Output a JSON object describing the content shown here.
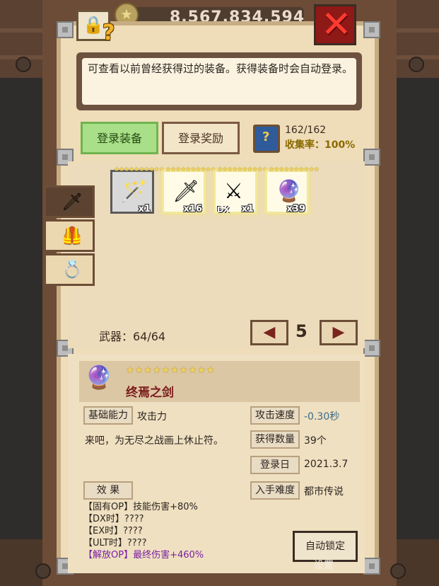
{
  "header": {
    "currency": "8,567,834,594"
  },
  "description": "可查看以前曾经获得过的装备。获得装备时会自动登录。",
  "tabs": [
    {
      "label": "登录装备",
      "active": true
    },
    {
      "label": "登录奖励",
      "active": false
    }
  ],
  "collection": {
    "count": "162/162",
    "rate": "收集率：100%"
  },
  "side_tabs": [
    {
      "icon": "sword-icon",
      "active": true
    },
    {
      "icon": "armor-icon",
      "active": false
    },
    {
      "icon": "ring-icon",
      "active": false
    }
  ],
  "items": [
    {
      "icon": "golden-staff-icon",
      "stars": "★★★★★★★★★★",
      "qty": "x1",
      "dx": "",
      "selected": true
    },
    {
      "icon": "crimson-sword-icon",
      "stars": "★★★★★★★★★★",
      "qty": "x16",
      "dx": "",
      "selected": false
    },
    {
      "icon": "flame-sword-icon",
      "stars": "★★★★★★★★★★",
      "qty": "x1",
      "dx": "DX",
      "selected": false
    },
    {
      "icon": "dark-orb-sword-icon",
      "stars": "★★★★★★★★★★",
      "qty": "x39",
      "dx": "",
      "selected": false
    }
  ],
  "weapons_count": "武器：64/64",
  "page": "5",
  "pager": {
    "prev": "◀",
    "next": "▶"
  },
  "detail": {
    "stars": "★★★★★★★★★★",
    "name": "终焉之剑",
    "basic_label": "基础能力",
    "basic_value": "攻击力",
    "speed_label": "攻击速度",
    "speed_value": "-0.30秒",
    "flavor": "来吧，为无尽之战画上休止符。",
    "obtain_label": "获得数量",
    "obtain_value": "39个",
    "date_label": "登录日",
    "date_value": "2021.3.7",
    "diff_label": "入手难度",
    "diff_value": "都市传说",
    "effect_label": "效 果",
    "effects": [
      "【固有OP】技能伤害+80%",
      "【DX时】????",
      "【EX时】????",
      "【ULT时】????",
      "【解放OP】最终伤害+460%"
    ]
  },
  "buttons": {
    "autolock": "自动锁定",
    "setting": "设置"
  },
  "colors": {
    "tab_active": "#a9df88",
    "close": "#ff3b30",
    "rarity": "#f1d35a",
    "accent_purple": "#7a1fa3"
  }
}
